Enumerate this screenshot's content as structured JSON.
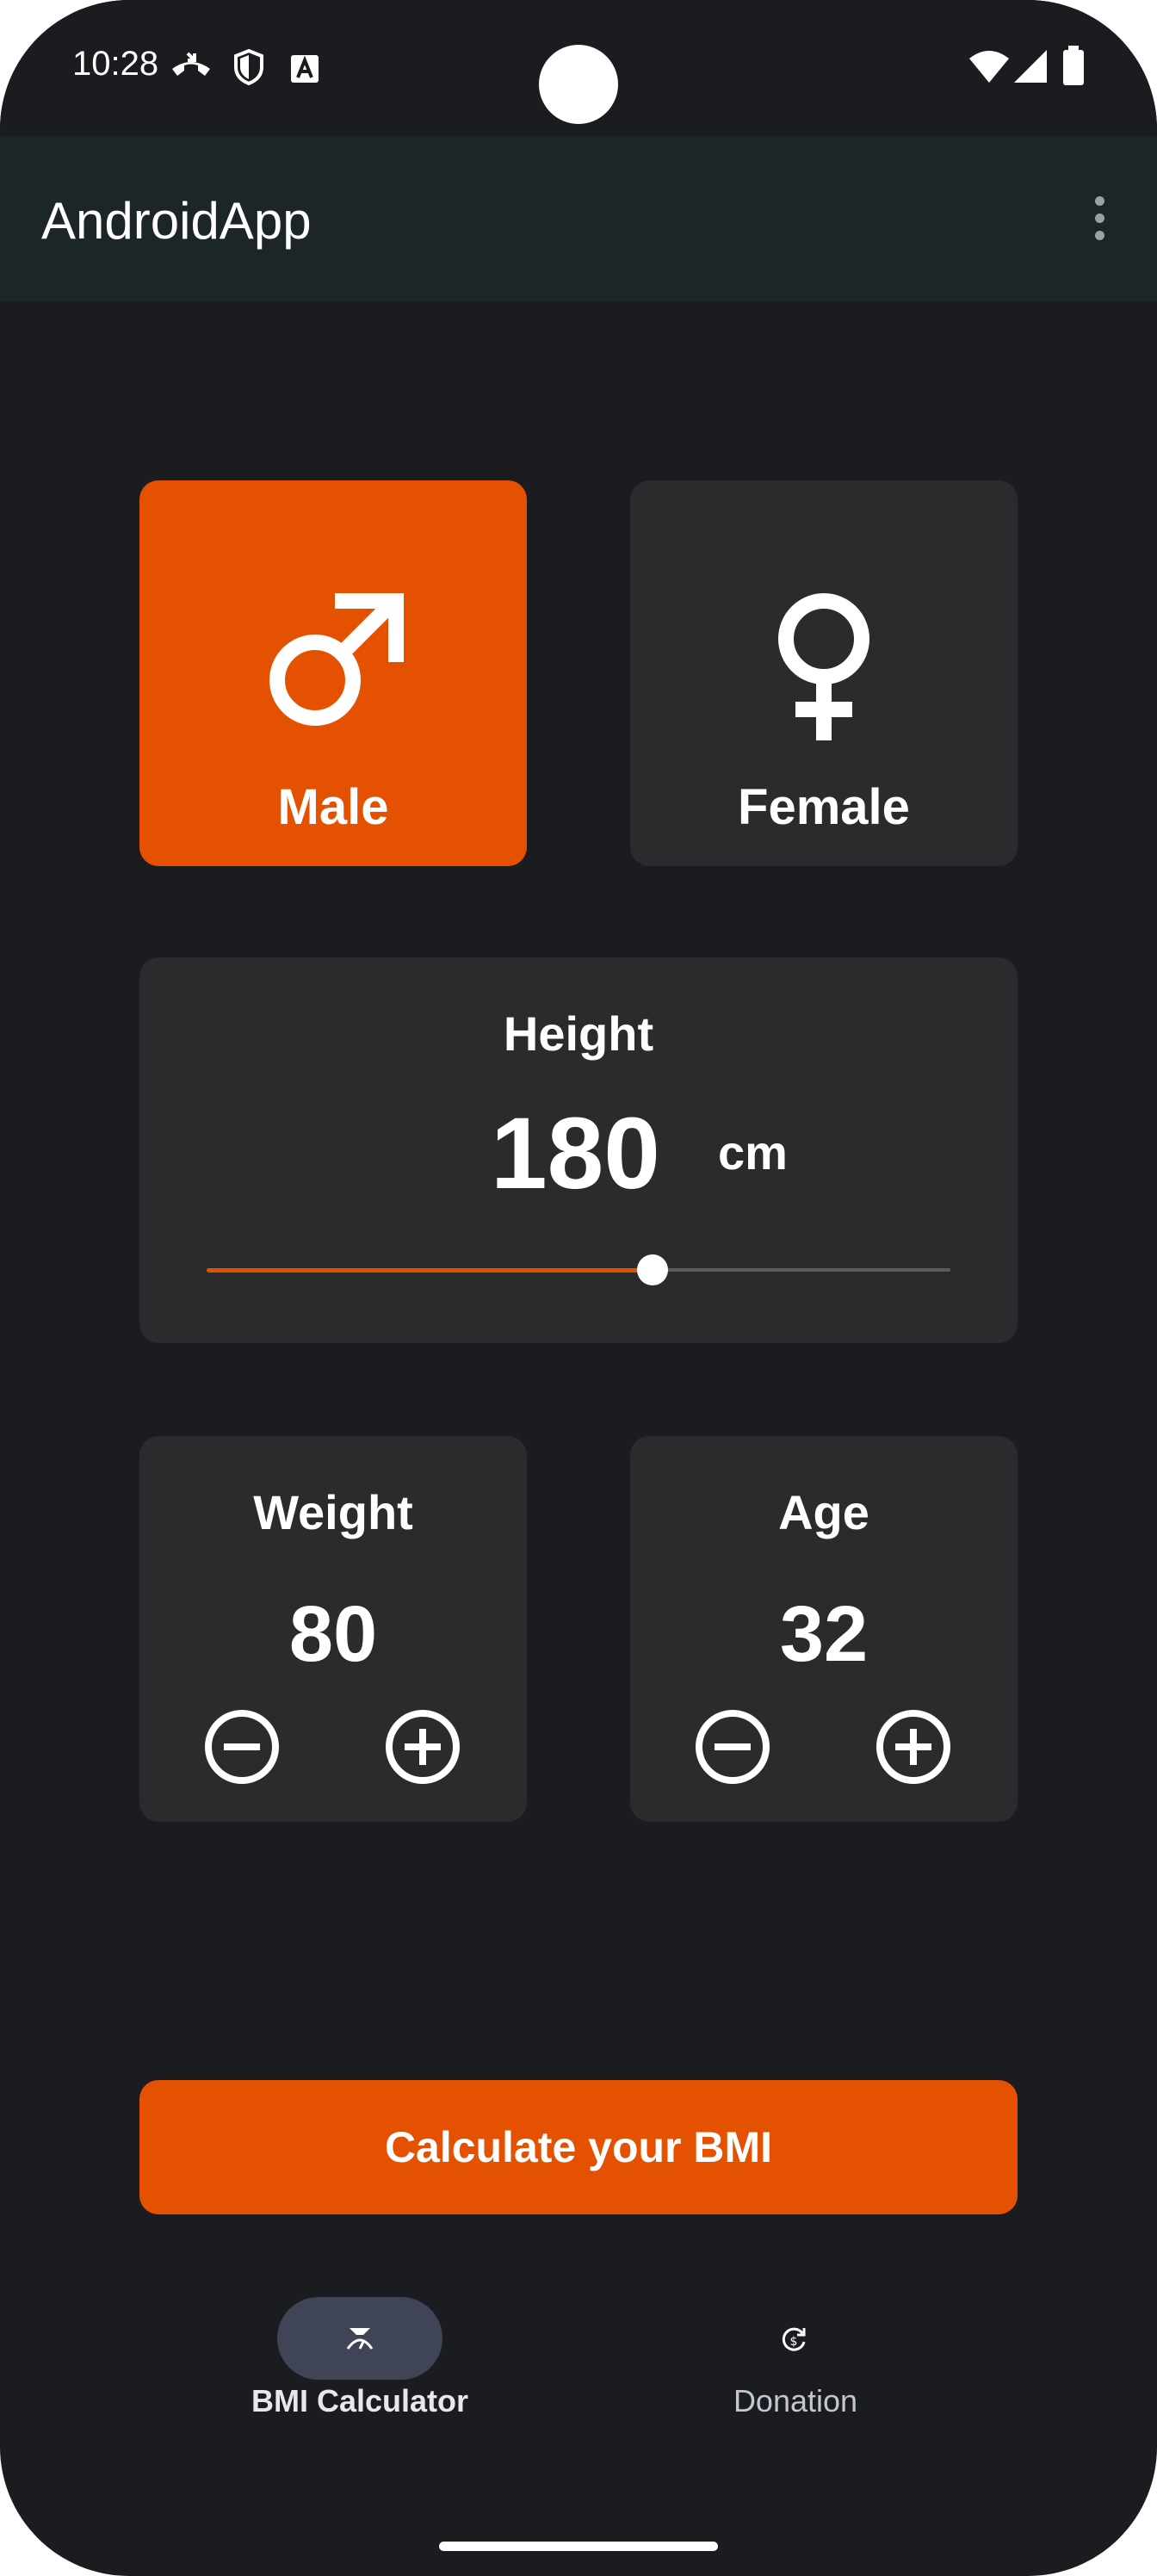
{
  "status_bar": {
    "time": "10:28",
    "left_icons": [
      "call-forwarding-icon",
      "shield-icon",
      "font-a-icon"
    ],
    "right_icons": [
      "wifi-icon",
      "signal-icon",
      "battery-icon"
    ]
  },
  "app_bar": {
    "title": "AndroidApp",
    "overflow_icon": "more-vert-icon"
  },
  "gender": {
    "male": {
      "label": "Male",
      "icon": "male-icon",
      "selected": true
    },
    "female": {
      "label": "Female",
      "icon": "female-icon",
      "selected": false
    }
  },
  "height": {
    "label": "Height",
    "value": "180",
    "unit": "cm",
    "slider_fraction": 0.6
  },
  "weight": {
    "label": "Weight",
    "value": "80",
    "minus_icon": "minus-circle-icon",
    "plus_icon": "plus-circle-icon"
  },
  "age": {
    "label": "Age",
    "value": "32",
    "minus_icon": "minus-circle-icon",
    "plus_icon": "plus-circle-icon"
  },
  "action": {
    "label": "Calculate your BMI"
  },
  "bottom_nav": [
    {
      "label": "BMI Calculator",
      "icon": "bmi-icon",
      "selected": true
    },
    {
      "label": "Donation",
      "icon": "donation-icon",
      "selected": false
    }
  ],
  "colors": {
    "accent": "#e45100",
    "background": "#1b1c20",
    "card": "#2b2b2d",
    "app_bar": "#1c2528",
    "nav_pill": "#3f4457"
  }
}
